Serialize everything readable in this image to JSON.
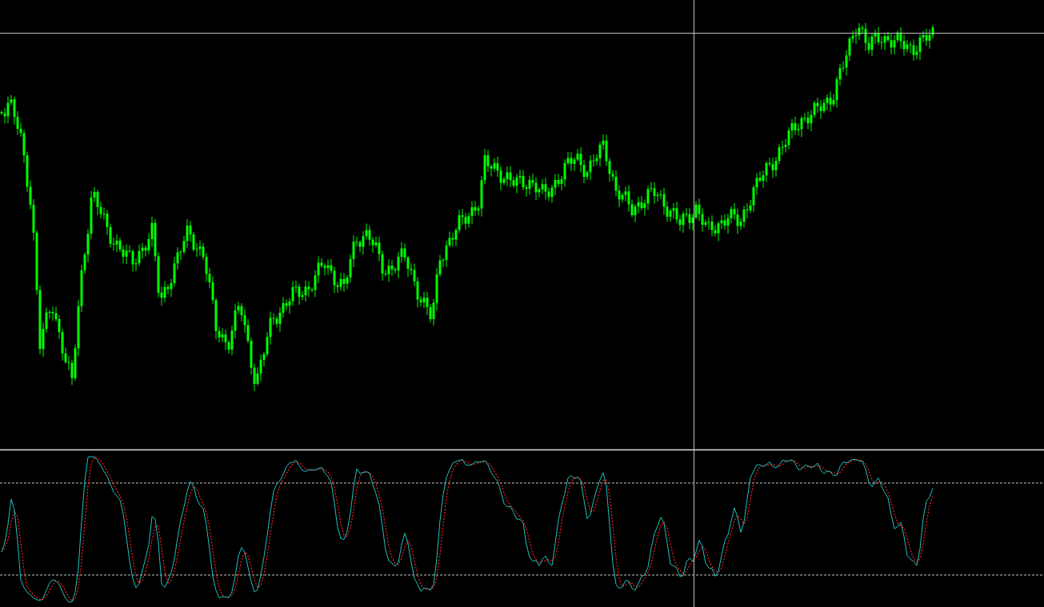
{
  "chart": {
    "crosshair": true
  }
}
